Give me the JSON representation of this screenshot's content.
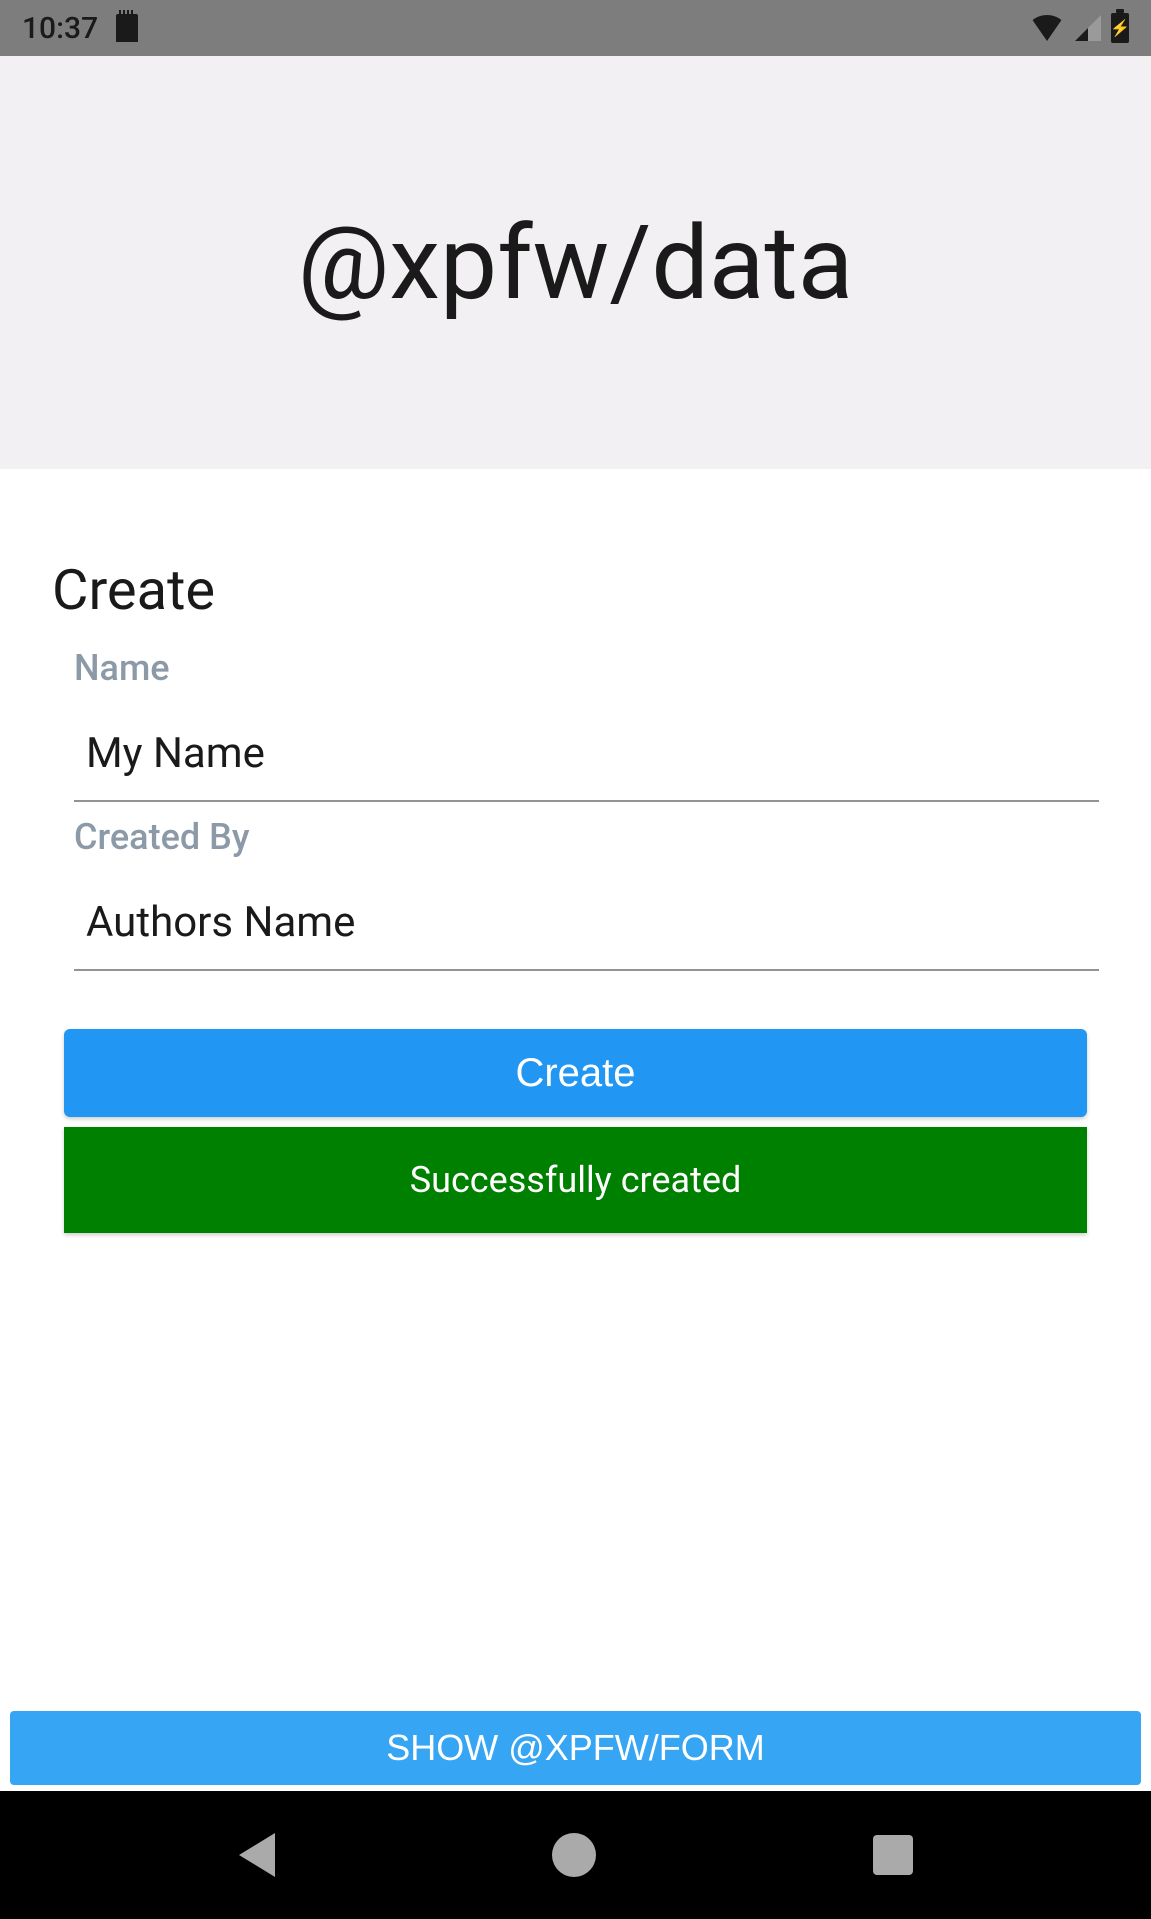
{
  "statusBar": {
    "time": "10:37"
  },
  "header": {
    "title": "@xpfw/data"
  },
  "form": {
    "sectionTitle": "Create",
    "fields": {
      "name": {
        "label": "Name",
        "value": "My Name"
      },
      "createdBy": {
        "label": "Created By",
        "value": "Authors Name"
      }
    },
    "createButtonLabel": "Create",
    "successMessage": "Successfully created"
  },
  "bottomButton": {
    "label": "SHOW @XPFW/FORM"
  }
}
